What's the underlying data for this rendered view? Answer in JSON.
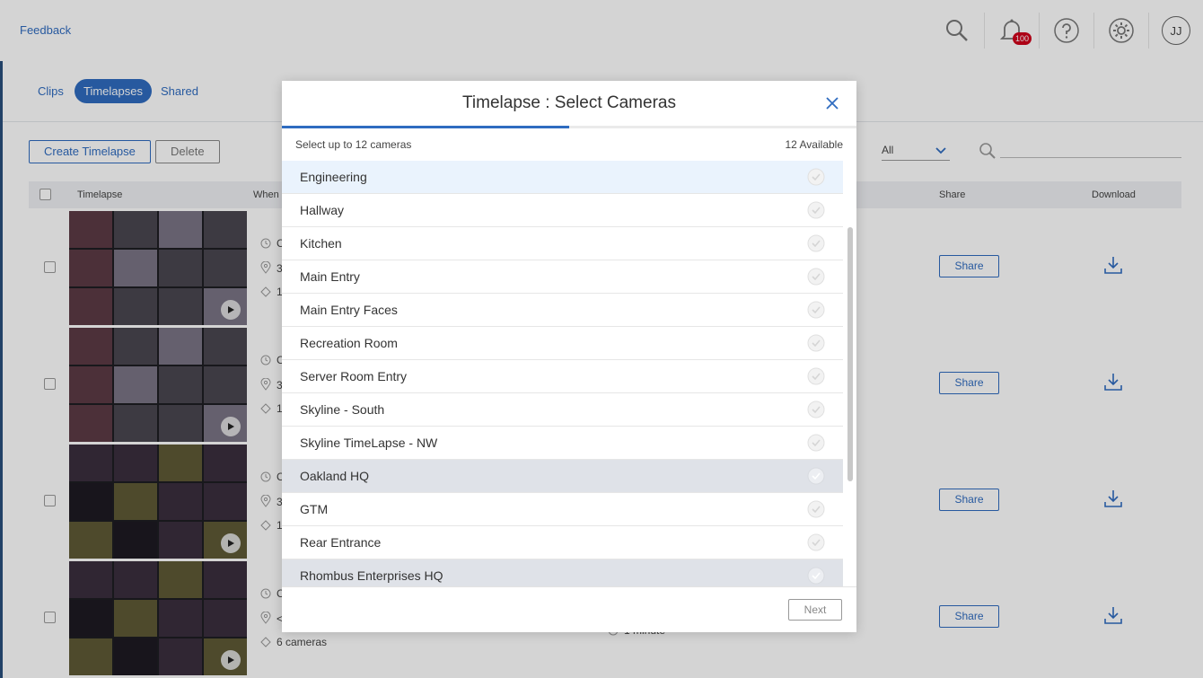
{
  "header": {
    "feedback_label": "Feedback",
    "notification_count": "100",
    "avatar_initials": "JJ"
  },
  "tabs": [
    {
      "label": "Clips"
    },
    {
      "label": "Timelapses"
    },
    {
      "label": "Shared"
    }
  ],
  "toolbar": {
    "create_label": "Create Timelapse",
    "delete_label": "Delete",
    "filter_value": "All"
  },
  "table": {
    "headers": {
      "timelapse": "Timelapse",
      "when": "When",
      "share": "Share",
      "download": "Download"
    },
    "rows": [
      {
        "meta_lines": [
          "C",
          "3",
          "1"
        ],
        "share_label": "Share"
      },
      {
        "meta_lines": [
          "C",
          "3",
          "1"
        ],
        "share_label": "Share"
      },
      {
        "meta_lines": [
          "C",
          "3",
          "1"
        ],
        "share_label": "Share"
      },
      {
        "meta_lines": [
          "C",
          "<",
          "6 cameras"
        ],
        "share_label": "Share",
        "duration": "1 minute"
      }
    ]
  },
  "modal": {
    "title": "Timelapse : Select Cameras",
    "subtitle": "Select up to 12 cameras",
    "available": "12 Available",
    "progress": 0.5,
    "cameras": [
      {
        "name": "Engineering",
        "state": "hover"
      },
      {
        "name": "Hallway",
        "state": "normal"
      },
      {
        "name": "Kitchen",
        "state": "normal"
      },
      {
        "name": "Main Entry",
        "state": "normal"
      },
      {
        "name": "Main Entry Faces",
        "state": "normal"
      },
      {
        "name": "Recreation Room",
        "state": "normal"
      },
      {
        "name": "Server Room Entry",
        "state": "normal"
      },
      {
        "name": "Skyline - South",
        "state": "normal"
      },
      {
        "name": "Skyline TimeLapse - NW",
        "state": "normal"
      },
      {
        "name": "Oakland HQ",
        "state": "group"
      },
      {
        "name": "GTM",
        "state": "normal"
      },
      {
        "name": "Rear Entrance",
        "state": "normal"
      },
      {
        "name": "Rhombus Enterprises HQ",
        "state": "group"
      }
    ],
    "next_label": "Next"
  },
  "colors": {
    "accent": "#2f6cc0",
    "badge": "#d0021b",
    "hover_row": "#eaf3fd",
    "group_row": "#dfe2e8"
  },
  "icons": [
    "search-icon",
    "bell-icon",
    "help-icon",
    "gear-icon",
    "close-icon",
    "check-circle-icon",
    "play-icon",
    "download-icon",
    "clock-icon",
    "location-icon",
    "tag-icon",
    "chevron-down-icon"
  ]
}
